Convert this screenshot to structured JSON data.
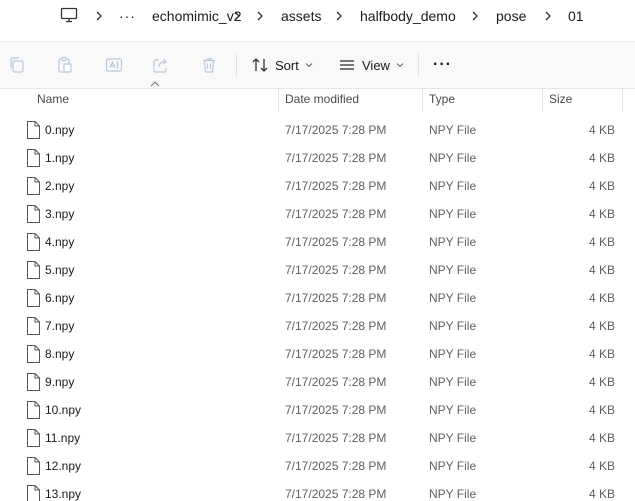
{
  "breadcrumb": {
    "more_label": "···",
    "items": [
      "echomimic_v2",
      "assets",
      "halfbody_demo",
      "pose",
      "01"
    ]
  },
  "commandbar": {
    "sort_label": "Sort",
    "view_label": "View",
    "more_label": "···"
  },
  "columns": {
    "name": "Name",
    "date": "Date modified",
    "type": "Type",
    "size": "Size"
  },
  "files": [
    {
      "name": "0.npy",
      "date": "7/17/2025 7:28 PM",
      "type": "NPY File",
      "size": "4 KB"
    },
    {
      "name": "1.npy",
      "date": "7/17/2025 7:28 PM",
      "type": "NPY File",
      "size": "4 KB"
    },
    {
      "name": "2.npy",
      "date": "7/17/2025 7:28 PM",
      "type": "NPY File",
      "size": "4 KB"
    },
    {
      "name": "3.npy",
      "date": "7/17/2025 7:28 PM",
      "type": "NPY File",
      "size": "4 KB"
    },
    {
      "name": "4.npy",
      "date": "7/17/2025 7:28 PM",
      "type": "NPY File",
      "size": "4 KB"
    },
    {
      "name": "5.npy",
      "date": "7/17/2025 7:28 PM",
      "type": "NPY File",
      "size": "4 KB"
    },
    {
      "name": "6.npy",
      "date": "7/17/2025 7:28 PM",
      "type": "NPY File",
      "size": "4 KB"
    },
    {
      "name": "7.npy",
      "date": "7/17/2025 7:28 PM",
      "type": "NPY File",
      "size": "4 KB"
    },
    {
      "name": "8.npy",
      "date": "7/17/2025 7:28 PM",
      "type": "NPY File",
      "size": "4 KB"
    },
    {
      "name": "9.npy",
      "date": "7/17/2025 7:28 PM",
      "type": "NPY File",
      "size": "4 KB"
    },
    {
      "name": "10.npy",
      "date": "7/17/2025 7:28 PM",
      "type": "NPY File",
      "size": "4 KB"
    },
    {
      "name": "11.npy",
      "date": "7/17/2025 7:28 PM",
      "type": "NPY File",
      "size": "4 KB"
    },
    {
      "name": "12.npy",
      "date": "7/17/2025 7:28 PM",
      "type": "NPY File",
      "size": "4 KB"
    },
    {
      "name": "13.npy",
      "date": "7/17/2025 7:28 PM",
      "type": "NPY File",
      "size": "4 KB"
    }
  ]
}
